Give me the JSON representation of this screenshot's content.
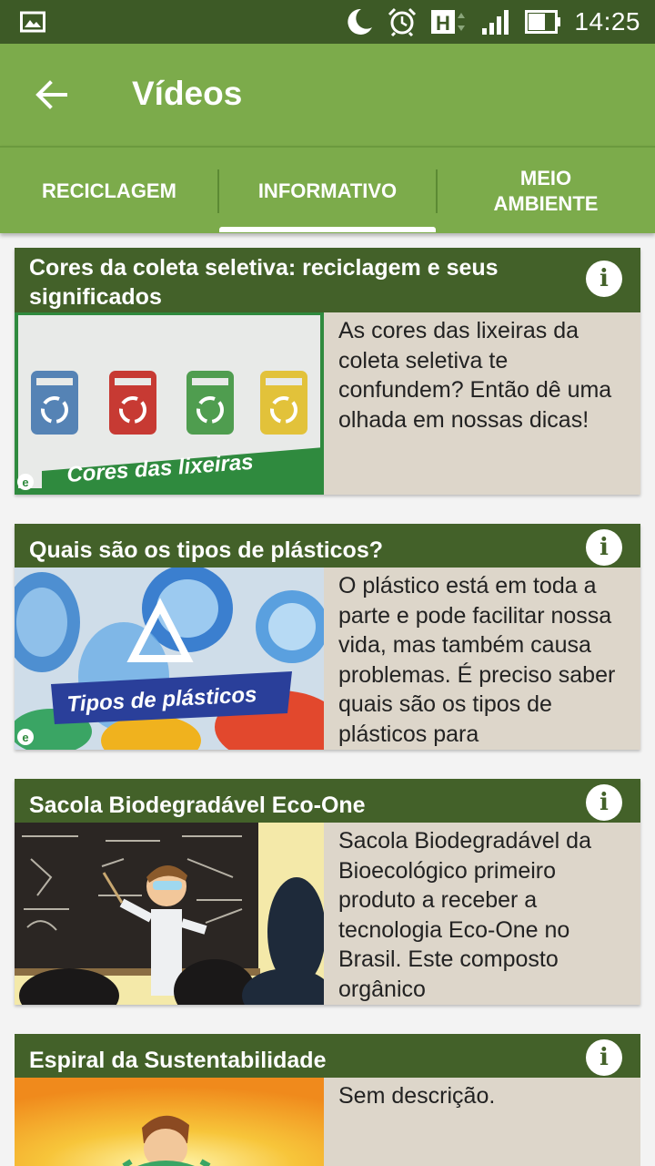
{
  "status_bar": {
    "time": "14:25"
  },
  "app_bar": {
    "title": "Vídeos"
  },
  "tabs": [
    {
      "label": "RECICLAGEM"
    },
    {
      "label": "INFORMATIVO"
    },
    {
      "label": "MEIO\nAMBIENTE"
    }
  ],
  "videos": [
    {
      "title": "Cores da coleta seletiva: reciclagem e seus significados",
      "thumbnail_text": "Cores das lixeiras",
      "description": "As cores das lixeiras da coleta seletiva te confundem? Então dê uma olhada em nossas dicas!"
    },
    {
      "title": "Quais são os tipos de plásticos?",
      "thumbnail_text": "Tipos de plásticos",
      "description": "O plástico está em toda a parte e pode facilitar nossa vida, mas também causa problemas. É preciso saber quais são os tipos de plásticos para"
    },
    {
      "title": "Sacola Biodegradável Eco-One",
      "description": "Sacola Biodegradável da Bioecológico primeiro produto a receber a tecnologia Eco-One no Brasil. Este composto orgânico"
    },
    {
      "title": "Espiral da Sustentabilidade",
      "description": "Sem descrição."
    }
  ]
}
